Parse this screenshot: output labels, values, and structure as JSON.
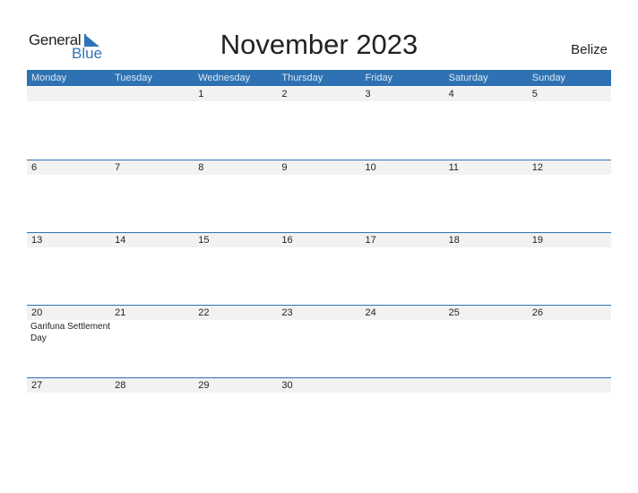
{
  "logo": {
    "general": "General",
    "blue": "Blue",
    "icon": "logo-triangle-icon"
  },
  "title": "November 2023",
  "country": "Belize",
  "colors": {
    "accent": "#2e72b3",
    "strip": "#f2f2f2"
  },
  "weekdays": [
    "Monday",
    "Tuesday",
    "Wednesday",
    "Thursday",
    "Friday",
    "Saturday",
    "Sunday"
  ],
  "weeks": [
    {
      "days": [
        "",
        "",
        "1",
        "2",
        "3",
        "4",
        "5"
      ],
      "holidays": [
        "",
        "",
        "",
        "",
        "",
        "",
        ""
      ]
    },
    {
      "days": [
        "6",
        "7",
        "8",
        "9",
        "10",
        "11",
        "12"
      ],
      "holidays": [
        "",
        "",
        "",
        "",
        "",
        "",
        ""
      ]
    },
    {
      "days": [
        "13",
        "14",
        "15",
        "16",
        "17",
        "18",
        "19"
      ],
      "holidays": [
        "",
        "",
        "",
        "",
        "",
        "",
        ""
      ]
    },
    {
      "days": [
        "20",
        "21",
        "22",
        "23",
        "24",
        "25",
        "26"
      ],
      "holidays": [
        "Garifuna Settlement Day",
        "",
        "",
        "",
        "",
        "",
        ""
      ]
    },
    {
      "days": [
        "27",
        "28",
        "29",
        "30",
        "",
        "",
        ""
      ],
      "holidays": [
        "",
        "",
        "",
        "",
        "",
        "",
        ""
      ]
    }
  ]
}
